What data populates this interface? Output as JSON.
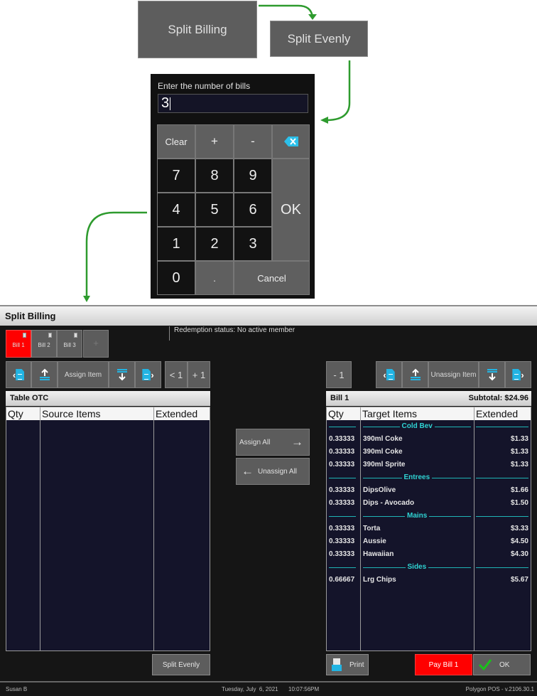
{
  "flow": {
    "split_billing_button": "Split Billing",
    "split_evenly_button": "Split Evenly",
    "arrow_color": "#2e9b2e"
  },
  "numpad": {
    "prompt": "Enter the number of bills",
    "value": "3",
    "keys": {
      "clear": "Clear",
      "plus": "+",
      "minus": "-",
      "backspace_icon": "backspace-icon",
      "k7": "7",
      "k8": "8",
      "k9": "9",
      "k4": "4",
      "k5": "5",
      "k6": "6",
      "k1": "1",
      "k2": "2",
      "k3": "3",
      "k0": "0",
      "dot": ".",
      "ok": "OK",
      "cancel": "Cancel"
    }
  },
  "window": {
    "title": "Split Billing",
    "bill_tabs": [
      {
        "label": "Bill 1",
        "active": true
      },
      {
        "label": "Bill 2",
        "active": false
      },
      {
        "label": "Bill 3",
        "active": false
      },
      {
        "label": "+",
        "active": false
      }
    ],
    "redemption_status": "Redemption status: No active member",
    "left_toolbar": {
      "assign_item": "Assign Item",
      "less_one": "< 1",
      "plus_one": "+ 1"
    },
    "right_toolbar": {
      "minus_one": "- 1",
      "unassign_item": "Unassign Item"
    },
    "source_panel": {
      "title": "Table OTC",
      "columns": [
        "Qty",
        "Source Items",
        "Extended"
      ],
      "rows": []
    },
    "middle": {
      "assign_all": "Assign All",
      "unassign_all": "Unassign All"
    },
    "target_panel": {
      "title": "Bill 1",
      "subtotal": "Subtotal: $24.96",
      "columns": [
        "Qty",
        "Target Items",
        "Extended"
      ],
      "groups": [
        {
          "category": "Cold Bev",
          "items": [
            {
              "qty": "0.33333",
              "name": "390ml Coke",
              "extended": "$1.33"
            },
            {
              "qty": "0.33333",
              "name": "390ml Coke",
              "extended": "$1.33"
            },
            {
              "qty": "0.33333",
              "name": "390ml Sprite",
              "extended": "$1.33"
            }
          ]
        },
        {
          "category": "Entrees",
          "items": [
            {
              "qty": "0.33333",
              "name": "DipsOlive",
              "extended": "$1.66"
            },
            {
              "qty": "0.33333",
              "name": "Dips - Avocado",
              "extended": "$1.50"
            }
          ]
        },
        {
          "category": "Mains",
          "items": [
            {
              "qty": "0.33333",
              "name": "Torta",
              "extended": "$3.33"
            },
            {
              "qty": "0.33333",
              "name": "Aussie",
              "extended": "$4.50"
            },
            {
              "qty": "0.33333",
              "name": "Hawaiian",
              "extended": "$4.30"
            }
          ]
        },
        {
          "category": "Sides",
          "items": [
            {
              "qty": "0.66667",
              "name": "Lrg Chips",
              "extended": "$5.67"
            }
          ]
        }
      ]
    },
    "bottom_buttons": {
      "split_evenly": "Split Evenly",
      "print": "Print",
      "pay_bill": "Pay Bill 1",
      "ok": "OK"
    },
    "status_bar": {
      "user": "Susan B",
      "date": "Tuesday, July  6, 2021",
      "time": "10:07:56PM",
      "version": "Polygon POS - v.2106.30.1"
    },
    "colors": {
      "active_tab": "#ff0000",
      "pay_button": "#ff0000",
      "category_text": "#2fd3d3",
      "accent_icon": "#22b4e3"
    }
  }
}
